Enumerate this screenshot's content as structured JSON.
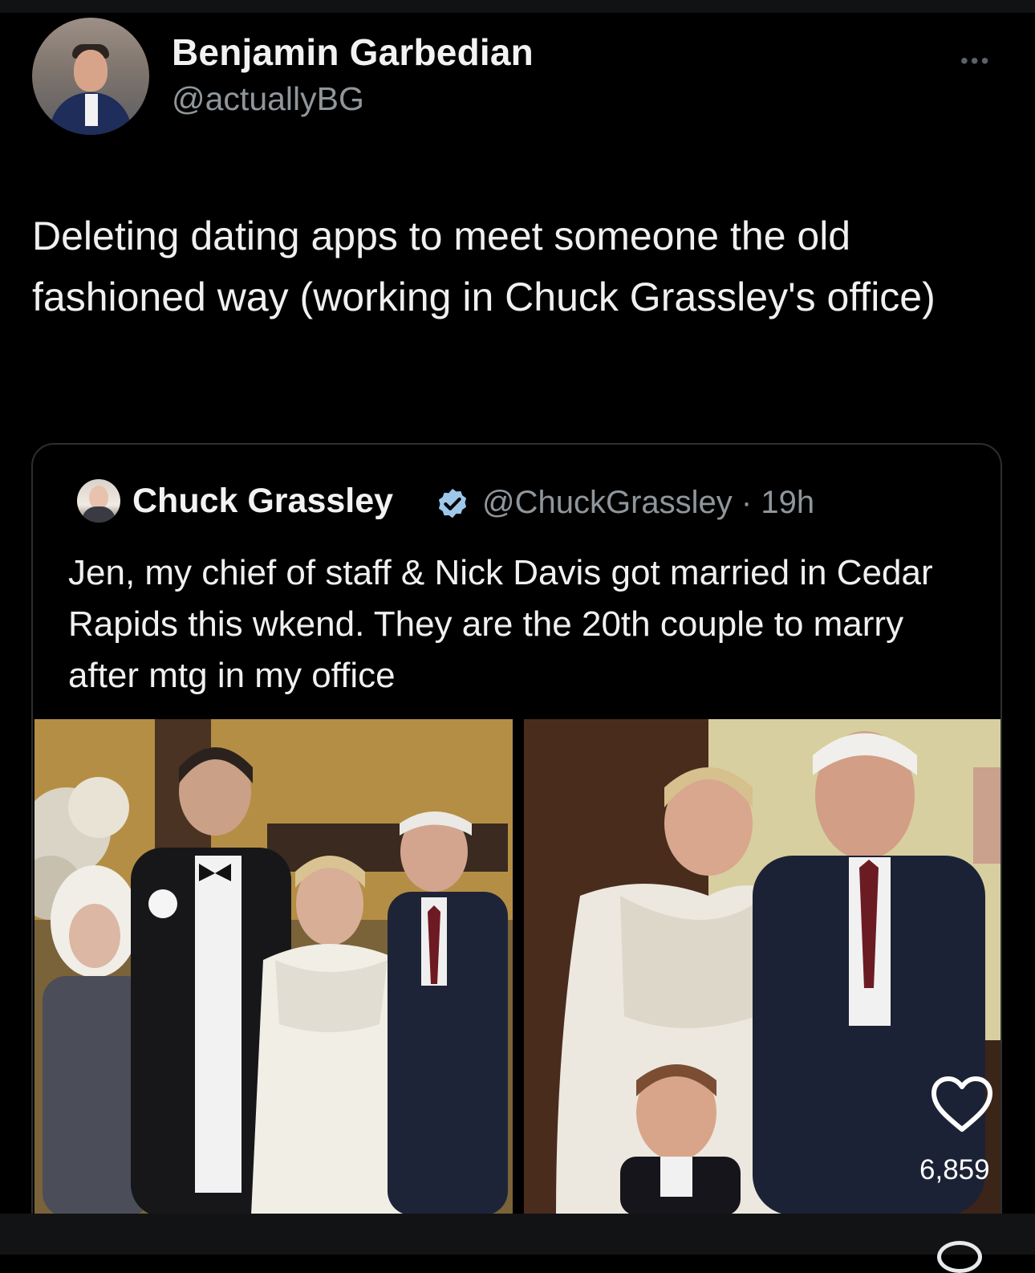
{
  "post": {
    "author_name": "Benjamin Garbedian",
    "author_handle": "@actuallyBG",
    "more_icon": "more-horizontal-icon",
    "text": "Deleting dating apps to meet someone the old fashioned way (working in Chuck Grassley's office)",
    "like_count": "6,859",
    "like_icon": "heart-icon"
  },
  "quote": {
    "author_name": "Chuck Grassley",
    "verified_icon": "verified-badge-icon",
    "handle_time": "@ChuckGrassley · 19h",
    "text": "Jen, my chief of staff & Nick Davis got married in Cedar Rapids this wkend. They are the 20th couple to marry after mtg in my office",
    "images": [
      "wedding-photo-group",
      "wedding-photo-couple-with-child"
    ]
  },
  "colors": {
    "background": "#000000",
    "text": "#f0f0f0",
    "secondary_text": "#8f969b",
    "verified_blue": "#1d9bf0"
  }
}
